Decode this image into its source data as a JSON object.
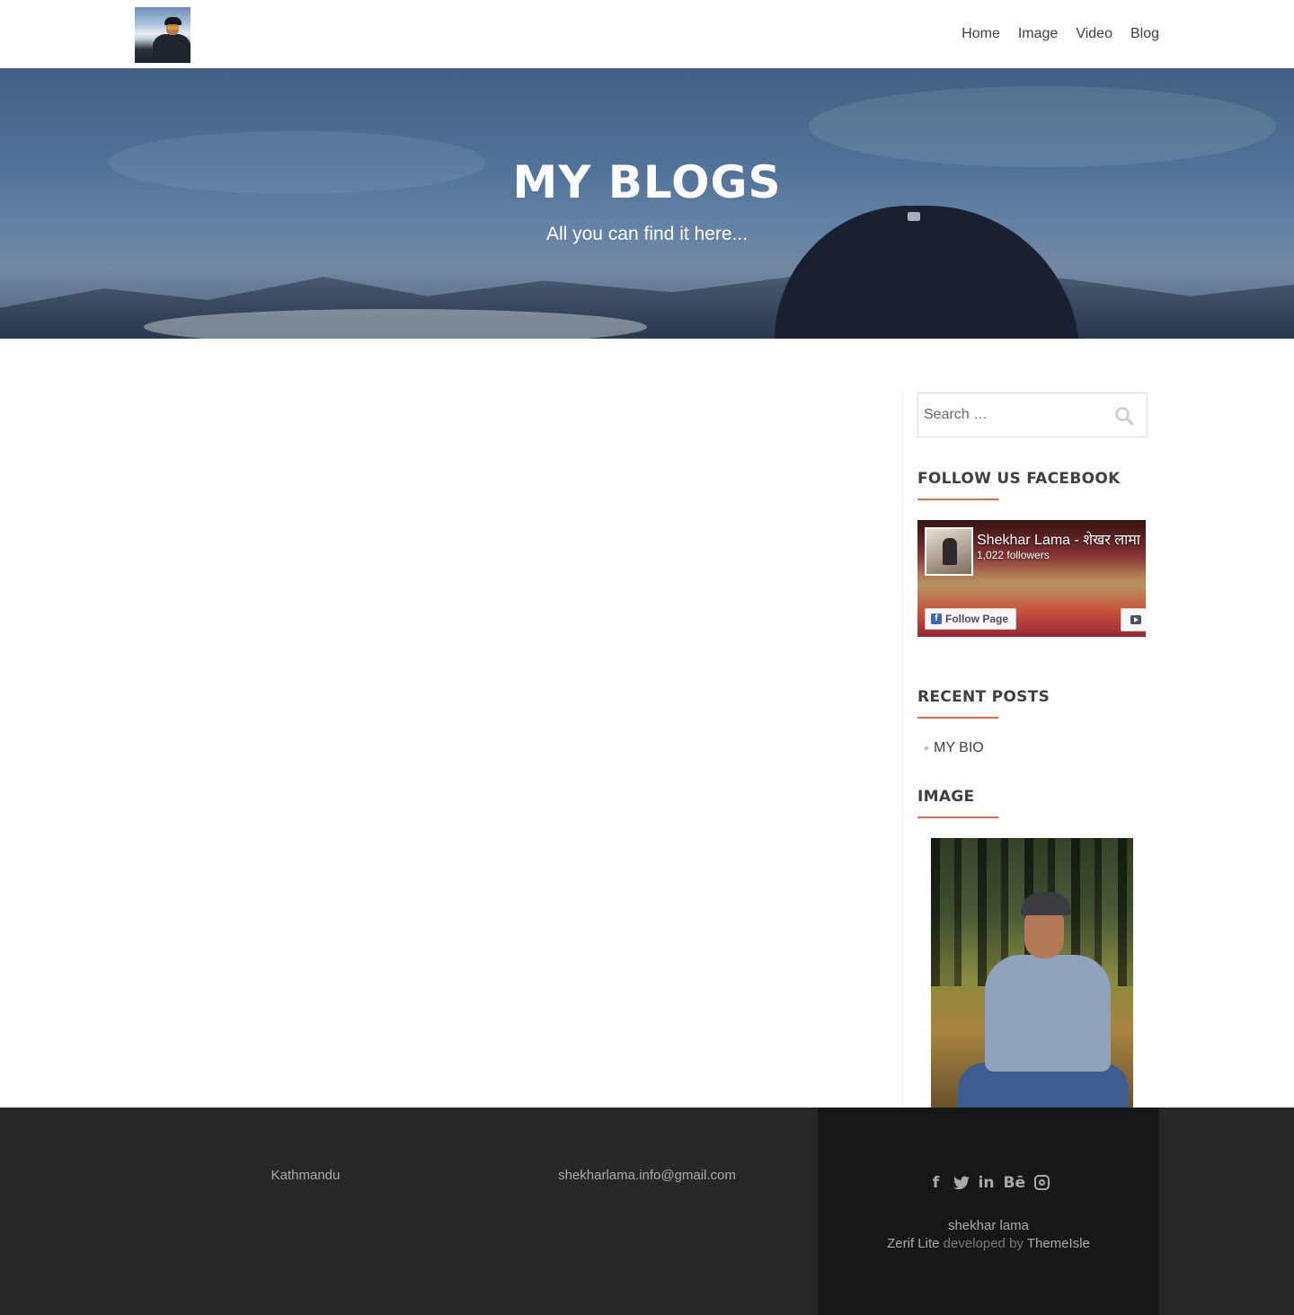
{
  "header": {
    "logo_alt": "site logo",
    "nav": [
      "Home",
      "Image",
      "Video",
      "Blog"
    ]
  },
  "hero": {
    "title": "MY BLOGS",
    "subtitle": "All you can find it here..."
  },
  "sidebar": {
    "search": {
      "placeholder": "Search …",
      "icon": "search-icon"
    },
    "facebook_widget": {
      "title": "FOLLOW US FACEBOOK",
      "page_name": "Shekhar Lama - शेखर लामा",
      "followers": "1,022 followers",
      "follow_label": "Follow Page"
    },
    "recent_posts": {
      "title": "RECENT POSTS",
      "items": [
        "MY BIO"
      ]
    },
    "image_widget": {
      "title": "IMAGE"
    }
  },
  "footer": {
    "location": "Kathmandu",
    "email": "shekharlama.info@gmail.com",
    "social_icons": [
      "facebook-icon",
      "twitter-icon",
      "linkedin-icon",
      "behance-icon",
      "instagram-icon"
    ],
    "author": "shekhar lama",
    "theme_name": "Zerif Lite",
    "developed_by": "developed by",
    "developer": "ThemeIsle"
  },
  "colors": {
    "accent": "#e96656",
    "footer_bg": "#272727",
    "footer_dark": "#171717"
  }
}
